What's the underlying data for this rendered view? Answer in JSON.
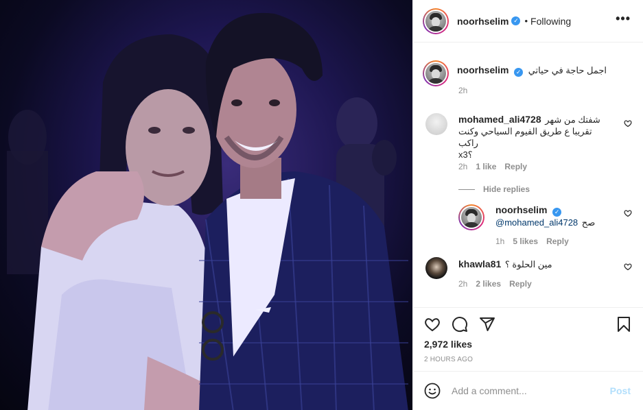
{
  "header": {
    "username": "noorhselim",
    "separator": "•",
    "follow_status": "Following",
    "more_label": "•••"
  },
  "caption": {
    "username": "noorhselim",
    "text": "اجمل حاجة في حياتي",
    "time": "2h"
  },
  "comments": [
    {
      "username": "mohamed_ali4728",
      "text_line1": "شفتك من شهر",
      "text_line2": "تقريبا ع طريق الفيوم السياحي وكنت راكب",
      "text_line3": "x3؟",
      "time": "2h",
      "likes": "1 like",
      "reply": "Reply",
      "hide_replies": "Hide replies",
      "replies": [
        {
          "username": "noorhselim",
          "mention": "@mohamed_ali4728",
          "text": "صح",
          "time": "1h",
          "likes": "5 likes",
          "reply": "Reply"
        }
      ]
    },
    {
      "username": "khawla81",
      "text": "مين الحلوة ؟",
      "time": "2h",
      "likes": "2 likes",
      "reply": "Reply"
    }
  ],
  "post_stats": {
    "likes": "2,972 likes",
    "time_ago": "2 HOURS AGO"
  },
  "comment_box": {
    "placeholder": "Add a comment...",
    "post_label": "Post"
  },
  "icons": {
    "verified": "verified-badge-icon",
    "heart": "heart-icon",
    "comment": "comment-icon",
    "share": "paper-plane-icon",
    "save": "bookmark-icon",
    "emoji": "smiley-icon",
    "more": "more-dots-icon"
  },
  "colors": {
    "link_blue": "#00376b",
    "verified_blue": "#3897f0",
    "post_disabled": "#b2dffc",
    "muted_text": "#8e8e8e"
  }
}
